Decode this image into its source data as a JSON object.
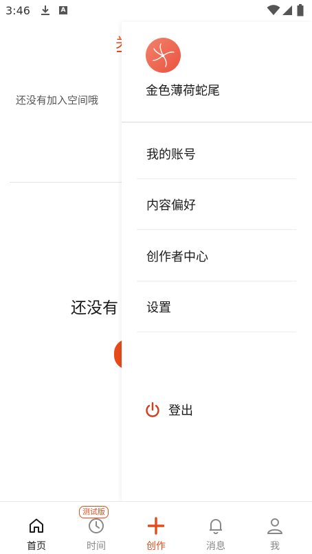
{
  "status_bar": {
    "time": "3:46",
    "download_icon": "download-icon",
    "app_icon": "A"
  },
  "background": {
    "empty_space_text": "还没有加入空间哦",
    "big_text": "还没有",
    "tab_partial": "关"
  },
  "drawer": {
    "username": "金色薄荷蛇尾",
    "menu": [
      {
        "label": "我的账号"
      },
      {
        "label": "内容偏好"
      },
      {
        "label": "创作者中心"
      },
      {
        "label": "设置"
      }
    ],
    "logout_label": "登出"
  },
  "bottom_nav": {
    "beta_badge": "测试版",
    "items": [
      {
        "label": "首页",
        "icon": "home-icon"
      },
      {
        "label": "时间",
        "icon": "clock-icon"
      },
      {
        "label": "创作",
        "icon": "plus-icon"
      },
      {
        "label": "消息",
        "icon": "bell-icon"
      },
      {
        "label": "我",
        "icon": "person-icon"
      }
    ]
  },
  "colors": {
    "accent": "#e64a19",
    "avatar": "#ef6a50"
  }
}
